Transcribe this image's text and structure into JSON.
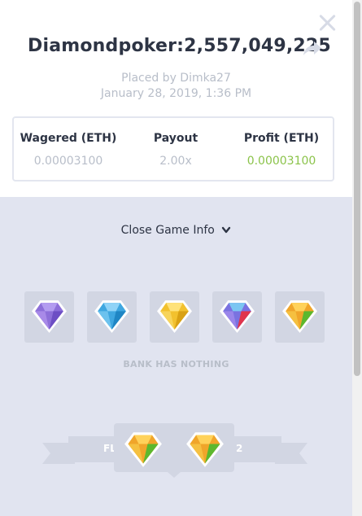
{
  "modal": {
    "title": "Diamondpoker:2,557,049,225",
    "placed_by": "Placed by Dimka27",
    "date": "January 28, 2019, 1:36 PM",
    "icons": {
      "close": "close-icon",
      "share": "share-arrow-icon"
    }
  },
  "stats": [
    {
      "label": "Wagered (ETH)",
      "value": "0.00003100"
    },
    {
      "label": "Payout",
      "value": "2.00x"
    },
    {
      "label": "Profit (ETH)",
      "value": "0.00003100",
      "color": "#8bc34a"
    }
  ],
  "game": {
    "toggle_label": "Close Game Info",
    "player_gems": [
      "purple",
      "blue",
      "yellow",
      "red-blue",
      "orange-green"
    ],
    "bank_text": "BANK HAS NOTHING",
    "result": {
      "left_label": "FL",
      "right_label": "2",
      "gems": [
        "orange-green",
        "orange-green"
      ]
    }
  },
  "colors": {
    "accent_green": "#8bc34a",
    "muted_text": "#b8bec9",
    "panel_bg": "#e1e4f0",
    "tile_bg": "#d2d6e3"
  }
}
